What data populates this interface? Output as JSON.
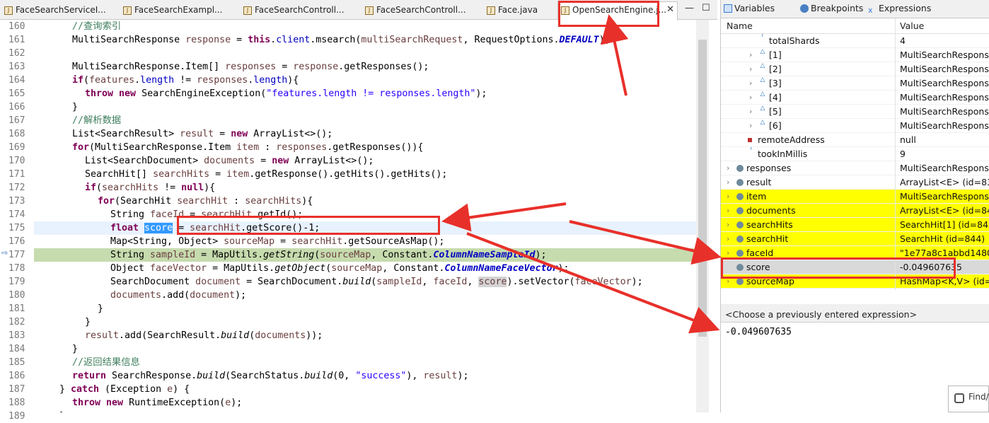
{
  "editor": {
    "tabs": [
      {
        "label": "FaceSearchServiceI...",
        "active": false
      },
      {
        "label": "FaceSearchExampl...",
        "active": false
      },
      {
        "label": "FaceSearchControll...",
        "active": false
      },
      {
        "label": "FaceSearchControll...",
        "active": false
      },
      {
        "label": "Face.java",
        "active": false
      },
      {
        "label": "OpenSearchEngine.j...",
        "active": true
      }
    ],
    "close_glyph": "✕",
    "minimize_glyph": "—",
    "maximize_glyph": "☐",
    "line_numbers": [
      "160",
      "161",
      "162",
      "163",
      "164",
      "165",
      "166",
      "167",
      "168",
      "169",
      "170",
      "171",
      "172",
      "173",
      "174",
      "175",
      "176",
      "177",
      "178",
      "179",
      "180",
      "181",
      "182",
      "183",
      "184",
      "185",
      "186",
      "187",
      "188",
      "189"
    ],
    "selected_word": "score"
  },
  "variables_panel": {
    "tabs": [
      {
        "label": "Variables",
        "icon": "variables-icon"
      },
      {
        "label": "Breakpoints",
        "icon": "breakpoints-icon"
      },
      {
        "label": "Expressions",
        "icon": "expressions-icon"
      }
    ],
    "headers": {
      "name": "Name",
      "value": "Value"
    },
    "rows": [
      {
        "name": "totalShards",
        "value": "4",
        "icon": "field-icon",
        "indent": 2,
        "expand": false,
        "highlight": false
      },
      {
        "name": "[1]",
        "value": "MultiSearchResponse$",
        "icon": "array-element-icon",
        "indent": 2,
        "expand": true,
        "highlight": false
      },
      {
        "name": "[2]",
        "value": "MultiSearchResponse$",
        "icon": "array-element-icon",
        "indent": 2,
        "expand": true,
        "highlight": false
      },
      {
        "name": "[3]",
        "value": "MultiSearchResponse$",
        "icon": "array-element-icon",
        "indent": 2,
        "expand": true,
        "highlight": false
      },
      {
        "name": "[4]",
        "value": "MultiSearchResponse$",
        "icon": "array-element-icon",
        "indent": 2,
        "expand": true,
        "highlight": false
      },
      {
        "name": "[5]",
        "value": "MultiSearchResponse$",
        "icon": "array-element-icon",
        "indent": 2,
        "expand": true,
        "highlight": false
      },
      {
        "name": "[6]",
        "value": "MultiSearchResponse$",
        "icon": "array-element-icon",
        "indent": 2,
        "expand": true,
        "highlight": false
      },
      {
        "name": "remoteAddress",
        "value": "null",
        "icon": "private-field-icon",
        "indent": 1,
        "expand": false,
        "highlight": false
      },
      {
        "name": "tookInMillis",
        "value": "9",
        "icon": "field-icon",
        "indent": 1,
        "expand": false,
        "highlight": false
      },
      {
        "name": "responses",
        "value": "MultiSearchResponse$",
        "icon": "local-variable-icon",
        "indent": 0,
        "expand": true,
        "highlight": false
      },
      {
        "name": "result",
        "value": "ArrayList<E>  (id=833",
        "icon": "local-variable-icon",
        "indent": 0,
        "expand": true,
        "highlight": false
      },
      {
        "name": "item",
        "value": "MultiSearchResponse$",
        "icon": "local-variable-icon",
        "indent": 0,
        "expand": true,
        "highlight": true
      },
      {
        "name": "documents",
        "value": "ArrayList<E>  (id=842",
        "icon": "local-variable-icon",
        "indent": 0,
        "expand": true,
        "highlight": true
      },
      {
        "name": "searchHits",
        "value": "SearchHit[1]  (id=843)",
        "icon": "local-variable-icon",
        "indent": 0,
        "expand": true,
        "highlight": true
      },
      {
        "name": "searchHit",
        "value": "SearchHit  (id=844)",
        "icon": "local-variable-icon",
        "indent": 0,
        "expand": true,
        "highlight": true
      },
      {
        "name": "faceId",
        "value": "\"1e77a8c1abbd1480d",
        "icon": "local-variable-icon",
        "indent": 0,
        "expand": true,
        "highlight": true
      },
      {
        "name": "score",
        "value": "-0.049607635",
        "icon": "local-variable-icon",
        "indent": 0,
        "expand": false,
        "highlight": false,
        "selected": true
      },
      {
        "name": "sourceMap",
        "value": "HashMap<K,V>  (id=",
        "icon": "local-variable-icon",
        "indent": 0,
        "expand": true,
        "highlight": true
      }
    ],
    "expression_prompt": "<Choose a previously entered expression>",
    "detail_value": "-0.049607635",
    "find_label": "Find/"
  }
}
